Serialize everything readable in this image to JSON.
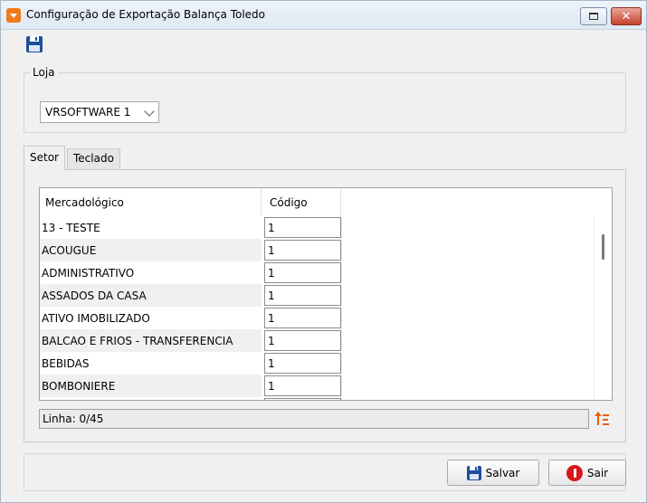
{
  "window": {
    "title": "Configuração de Exportação Balança Toledo"
  },
  "toolbar": {
    "save_icon": "floppy-disk-icon"
  },
  "loja": {
    "legend": "Loja",
    "selected": "VRSOFTWARE 1"
  },
  "tabs": [
    {
      "label": "Setor",
      "active": true
    },
    {
      "label": "Teclado",
      "active": false
    }
  ],
  "grid": {
    "columns": [
      "Mercadológico",
      "Código"
    ],
    "rows": [
      {
        "mercadologico": "13 - TESTE",
        "codigo": "1"
      },
      {
        "mercadologico": "ACOUGUE",
        "codigo": "1"
      },
      {
        "mercadologico": "ADMINISTRATIVO",
        "codigo": "1"
      },
      {
        "mercadologico": "ASSADOS DA CASA",
        "codigo": "1"
      },
      {
        "mercadologico": "ATIVO IMOBILIZADO",
        "codigo": "1"
      },
      {
        "mercadologico": "BALCAO E FRIOS - TRANSFERENCIA",
        "codigo": "1"
      },
      {
        "mercadologico": "BEBIDAS",
        "codigo": "1"
      },
      {
        "mercadologico": "BOMBONIERE",
        "codigo": "1"
      }
    ]
  },
  "status": {
    "text": "Linha: 0/45"
  },
  "buttons": {
    "salvar": "Salvar",
    "sair": "Sair"
  },
  "colors": {
    "accent_orange": "#e8600c",
    "close_red": "#c8412c",
    "save_blue": "#1d4f9c",
    "exit_red": "#d8161b"
  }
}
